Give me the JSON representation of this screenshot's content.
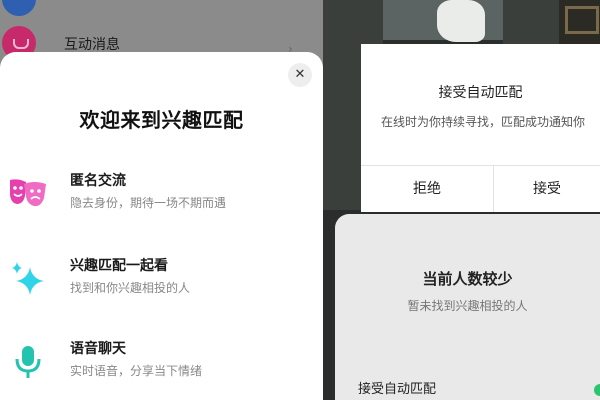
{
  "background_list": {
    "items": [
      {
        "title": "",
        "subtitle": ""
      },
      {
        "title": "互动消息",
        "subtitle": ""
      }
    ]
  },
  "welcome_sheet": {
    "close_icon": "close-icon",
    "title": "欢迎来到兴趣匹配",
    "features": [
      {
        "icon": "masks-icon",
        "title": "匿名交流",
        "description": "隐去身份，期待一场不期而遇"
      },
      {
        "icon": "sparkle-icon",
        "title": "兴趣匹配一起看",
        "description": "找到和你兴趣相投的人"
      },
      {
        "icon": "microphone-icon",
        "title": "语音聊天",
        "description": "实时语音，分享当下情绪"
      }
    ]
  },
  "auto_match_dialog": {
    "title": "接受自动匹配",
    "message": "在线时为你持续寻找，匹配成功通知你",
    "reject_label": "拒绝",
    "accept_label": "接受"
  },
  "status_panel": {
    "title": "当前人数较少",
    "subtitle": "暂未找到兴趣相投的人",
    "auto_match_label": "接受自动匹配"
  },
  "colors": {
    "masks": "#e63fae",
    "sparkle": "#2fd4e8",
    "microphone": "#24c3b0",
    "switch_on": "#2ec46f"
  }
}
